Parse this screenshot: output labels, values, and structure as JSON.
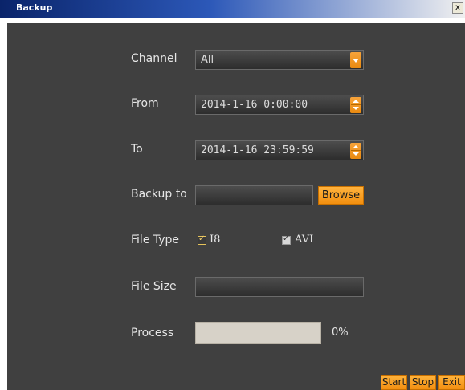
{
  "window": {
    "title": "Backup",
    "close_label": "x"
  },
  "form": {
    "channel": {
      "label": "Channel",
      "value": "All"
    },
    "from": {
      "label": "From",
      "value": "2014-1-16 0:00:00"
    },
    "to": {
      "label": "To",
      "value": "2014-1-16 23:59:59"
    },
    "backup_to": {
      "label": "Backup to",
      "value": "",
      "browse_label": "Browse"
    },
    "file_type": {
      "label": "File Type",
      "options": [
        {
          "label": "I8",
          "checked": true
        },
        {
          "label": "AVI",
          "checked": true
        }
      ]
    },
    "file_size": {
      "label": "File Size",
      "value": ""
    },
    "process": {
      "label": "Process",
      "percent_text": "0%",
      "progress": 0
    }
  },
  "actions": {
    "start_label": "Start",
    "stop_label": "Stop",
    "exit_label": "Exit"
  },
  "colors": {
    "accent": "#f28f10",
    "panel_bg": "#404040",
    "titlebar": "#0a246a"
  }
}
